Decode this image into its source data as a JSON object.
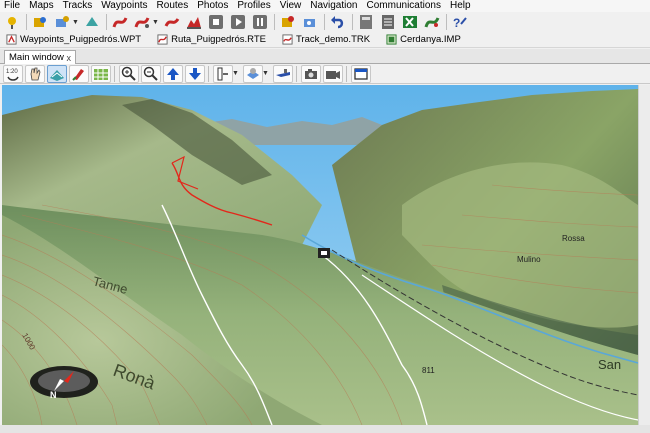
{
  "menu": [
    "File",
    "Maps",
    "Tracks",
    "Waypoints",
    "Routes",
    "Photos",
    "Profiles",
    "View",
    "Navigation",
    "Communications",
    "Help"
  ],
  "open_files": [
    {
      "label": "Waypoints_Puigpedrós.WPT",
      "icon": "waypoint-file-icon",
      "color": "#c62828"
    },
    {
      "label": "Ruta_Puigpedrós.RTE",
      "icon": "route-file-icon",
      "color": "#c62828"
    },
    {
      "label": "Track_demo.TRK",
      "icon": "track-file-icon",
      "color": "#c62828"
    },
    {
      "label": "Cerdanya.IMP",
      "icon": "map-file-icon",
      "color": "#2e7d32"
    }
  ],
  "window_tab": {
    "label": "Main window",
    "close": "x"
  },
  "map_labels": {
    "north": "N",
    "places": [
      "Tanne",
      "Ronà",
      "Mulino",
      "Rossa",
      "811",
      "1000",
      "San"
    ]
  },
  "colors": {
    "sky": "#7fc3ec",
    "terrain": "#8fae73",
    "track": "#e3271b",
    "road": "#ffffff"
  }
}
